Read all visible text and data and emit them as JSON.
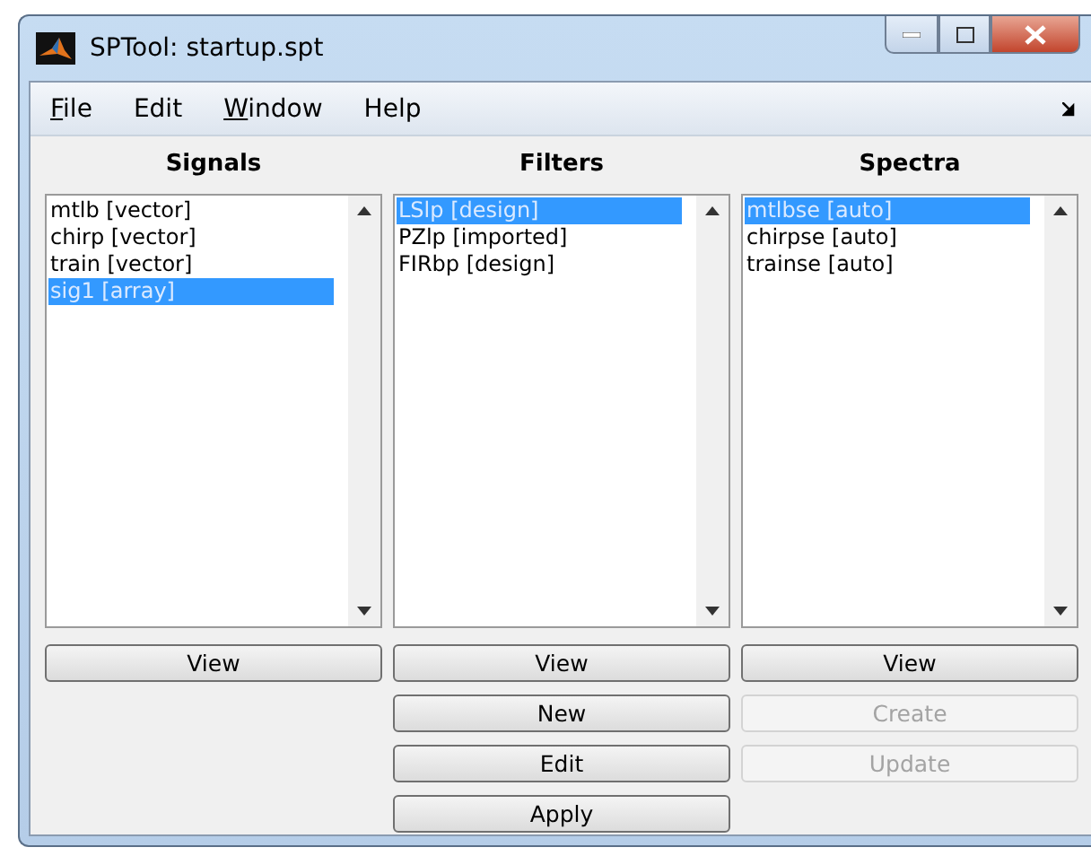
{
  "window": {
    "title": "SPTool: startup.spt"
  },
  "menu": [
    {
      "label": "File",
      "underline_first": true
    },
    {
      "label": "Edit",
      "underline_first": false
    },
    {
      "label": "Window",
      "underline_first": true
    },
    {
      "label": "Help",
      "underline_first": false
    }
  ],
  "columns": [
    {
      "heading": "Signals",
      "items": [
        {
          "label": "mtlb [vector]",
          "selected": false
        },
        {
          "label": "chirp [vector]",
          "selected": false
        },
        {
          "label": "train [vector]",
          "selected": false
        },
        {
          "label": "sig1 [array]",
          "selected": true
        }
      ],
      "buttons": [
        {
          "label": "View",
          "disabled": false
        }
      ]
    },
    {
      "heading": "Filters",
      "items": [
        {
          "label": "LSlp [design]",
          "selected": true
        },
        {
          "label": "PZlp [imported]",
          "selected": false
        },
        {
          "label": "FIRbp [design]",
          "selected": false
        }
      ],
      "buttons": [
        {
          "label": "View",
          "disabled": false
        },
        {
          "label": "New",
          "disabled": false
        },
        {
          "label": "Edit",
          "disabled": false
        },
        {
          "label": "Apply",
          "disabled": false
        }
      ]
    },
    {
      "heading": "Spectra",
      "items": [
        {
          "label": "mtlbse [auto]",
          "selected": true
        },
        {
          "label": "chirpse [auto]",
          "selected": false
        },
        {
          "label": "trainse [auto]",
          "selected": false
        }
      ],
      "buttons": [
        {
          "label": "View",
          "disabled": false
        },
        {
          "label": "Create",
          "disabled": true
        },
        {
          "label": "Update",
          "disabled": true
        }
      ]
    }
  ]
}
